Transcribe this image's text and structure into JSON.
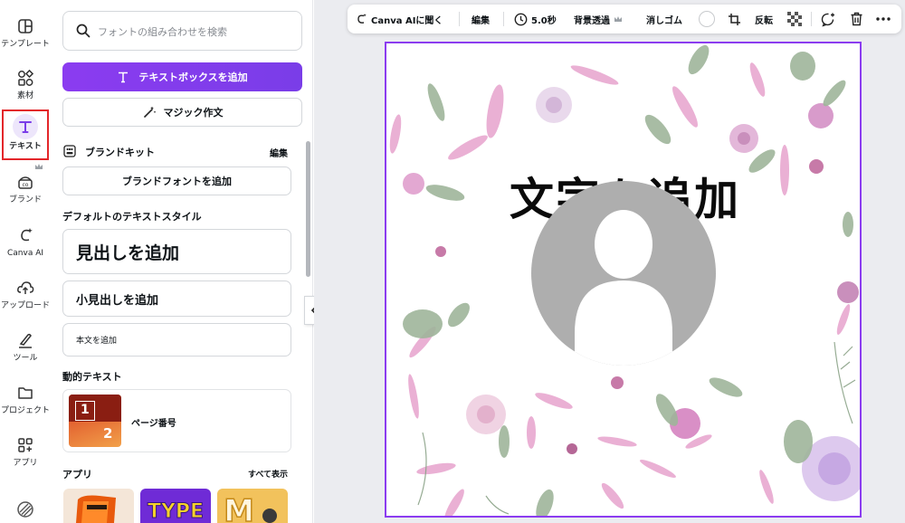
{
  "rail": {
    "items": [
      {
        "label": "テンプレート",
        "icon": "template-icon"
      },
      {
        "label": "素材",
        "icon": "elements-icon"
      },
      {
        "label": "テキスト",
        "icon": "text-icon"
      },
      {
        "label": "ブランド",
        "icon": "brand-icon"
      },
      {
        "label": "Canva AI",
        "icon": "canva-ai-icon"
      },
      {
        "label": "アップロード",
        "icon": "upload-icon"
      },
      {
        "label": "ツール",
        "icon": "tools-icon"
      },
      {
        "label": "プロジェクト",
        "icon": "folder-icon"
      },
      {
        "label": "アプリ",
        "icon": "apps-icon"
      }
    ],
    "active_index": 2
  },
  "panel": {
    "search_placeholder": "フォントの組み合わせを検索",
    "add_textbox": "テキストボックスを追加",
    "magic_write": "マジック作文",
    "brand_kit": "ブランドキット",
    "brand_edit": "編集",
    "add_brand_font": "ブランドフォントを追加",
    "default_styles": "デフォルトのテキストスタイル",
    "add_heading": "見出しを追加",
    "add_subheading": "小見出しを追加",
    "add_body": "本文を追加",
    "dynamic_text": "動的テキスト",
    "page_number": "ページ番号",
    "page_thumb_nums": [
      "1",
      "2"
    ],
    "apps": "アプリ",
    "show_all": "すべて表示"
  },
  "toolbar": {
    "canva_ai": "Canva AIに聞く",
    "edit": "編集",
    "duration": "5.0秒",
    "bg_remove": "背景透過",
    "eraser": "消しゴム",
    "flip": "反転"
  },
  "canvas": {
    "headline": "文字を追加"
  },
  "colors": {
    "accent": "#8b3cf0",
    "active_border": "#e3262a",
    "workspace_bg": "#ebecf0",
    "avatar_gray": "#aeaeae"
  }
}
